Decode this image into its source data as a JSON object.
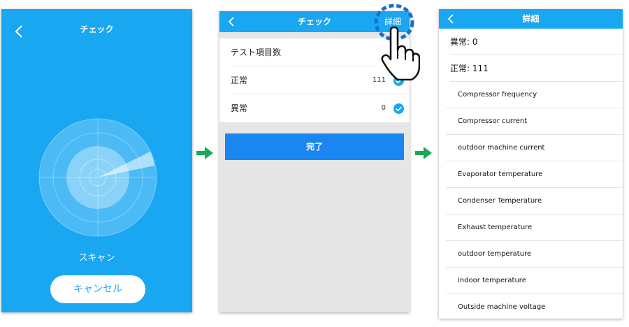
{
  "scan_screen": {
    "title": "チェック",
    "status": "スキャン",
    "cancel_label": "キャンセル"
  },
  "check_screen": {
    "title": "チェック",
    "detail_label": "詳細",
    "rows": [
      {
        "label": "テスト項目数",
        "count": ""
      },
      {
        "label": "正常",
        "count": "111"
      },
      {
        "label": "異常",
        "count": "0"
      }
    ],
    "done_label": "完了"
  },
  "detail_screen": {
    "title": "詳細",
    "abnormal": "異常: 0",
    "normal": "正常: 111",
    "items": [
      "Compressor frequency",
      "Compressor current",
      "outdoor machine current",
      "Evaporator temperature",
      "Condenser Temperature",
      "Exhaust temperature",
      "outdoor temperature",
      "indoor temperature",
      "Outside machine voltage"
    ]
  },
  "colors": {
    "primary": "#1aa7f2",
    "button_blue": "#1a86f2",
    "arrow_green": "#1aa85a",
    "highlight_ring": "#1a6fd1"
  },
  "icons": {
    "back": "chevron-left-icon",
    "check": "check-circle-icon",
    "flow_arrow": "arrow-right-icon",
    "hand": "pointing-hand-icon"
  }
}
